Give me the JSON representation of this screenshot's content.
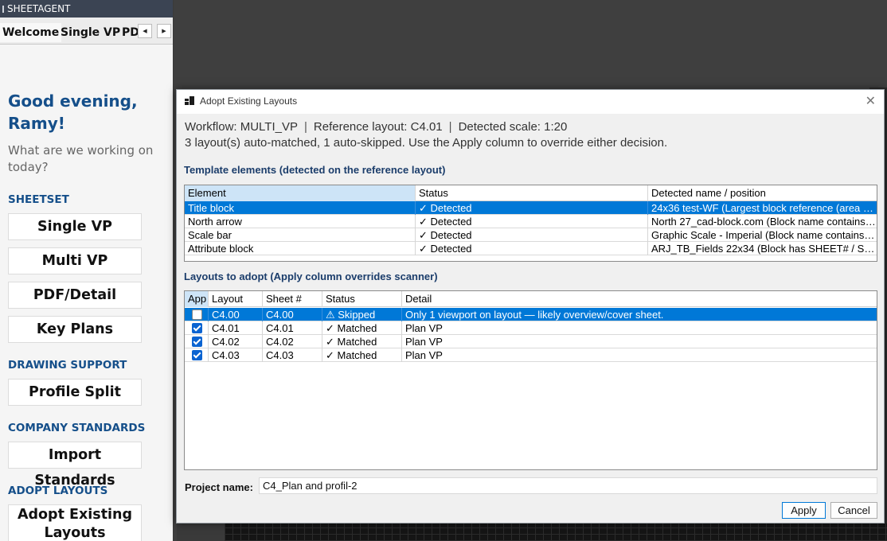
{
  "palette": {
    "title": "SHEETAGENT",
    "tabs": [
      "Welcome",
      "Single VP",
      "PD"
    ],
    "greeting": "Good evening, Ramy!",
    "subgreeting": "What are we working on today?",
    "sections": [
      {
        "header": "SHEETSET",
        "buttons": [
          "Single VP",
          "Multi VP",
          "PDF/Detail",
          "Key Plans"
        ]
      },
      {
        "header": "DRAWING SUPPORT",
        "buttons": [
          "Profile Split"
        ]
      },
      {
        "header": "COMPANY STANDARDS",
        "buttons": [
          "Import Standards"
        ]
      },
      {
        "header": "ADOPT LAYOUTS",
        "buttons": [
          "Adopt Existing Layouts"
        ]
      }
    ]
  },
  "dialog": {
    "title": "Adopt Existing Layouts",
    "workflow": "Workflow: MULTI_VP",
    "reference": "Reference layout: C4.01",
    "scale": "Detected scale: 1:20",
    "summary": "3 layout(s) auto-matched, 1 auto-skipped. Use the Apply column to override either decision.",
    "template_title": "Template elements (detected on the reference layout)",
    "template_columns": [
      "Element",
      "Status",
      "Detected name / position"
    ],
    "template_rows": [
      {
        "element": "Title block",
        "status": "✓ Detected",
        "detected": "24x36 test-WF  (Largest block reference (area ≈…",
        "selected": true
      },
      {
        "element": "North arrow",
        "status": "✓ Detected",
        "detected": "North 27_cad-block.com  (Block name contains …"
      },
      {
        "element": "Scale bar",
        "status": "✓ Detected",
        "detected": "Graphic Scale - Imperial  (Block name contains …"
      },
      {
        "element": "Attribute block",
        "status": "✓ Detected",
        "detected": "ARJ_TB_Fields 22x34  (Block has SHEET# / SHEE…"
      }
    ],
    "layouts_title": "Layouts to adopt (Apply column overrides scanner)",
    "layout_columns": [
      "App",
      "Layout",
      "Sheet #",
      "Status",
      "Detail"
    ],
    "layout_rows": [
      {
        "apply": false,
        "layout": "C4.00",
        "sheet": "C4.00",
        "status": "⚠ Skipped",
        "detail": "Only 1 viewport on layout — likely overview/cover sheet.",
        "selected": true
      },
      {
        "apply": true,
        "layout": "C4.01",
        "sheet": "C4.01",
        "status": "✓ Matched",
        "detail": "Plan VP"
      },
      {
        "apply": true,
        "layout": "C4.02",
        "sheet": "C4.02",
        "status": "✓ Matched",
        "detail": "Plan VP"
      },
      {
        "apply": true,
        "layout": "C4.03",
        "sheet": "C4.03",
        "status": "✓ Matched",
        "detail": "Plan VP"
      }
    ],
    "project_label": "Project name:",
    "project_name": "C4_Plan and profil-2",
    "apply_label": "Apply",
    "cancel_label": "Cancel"
  }
}
